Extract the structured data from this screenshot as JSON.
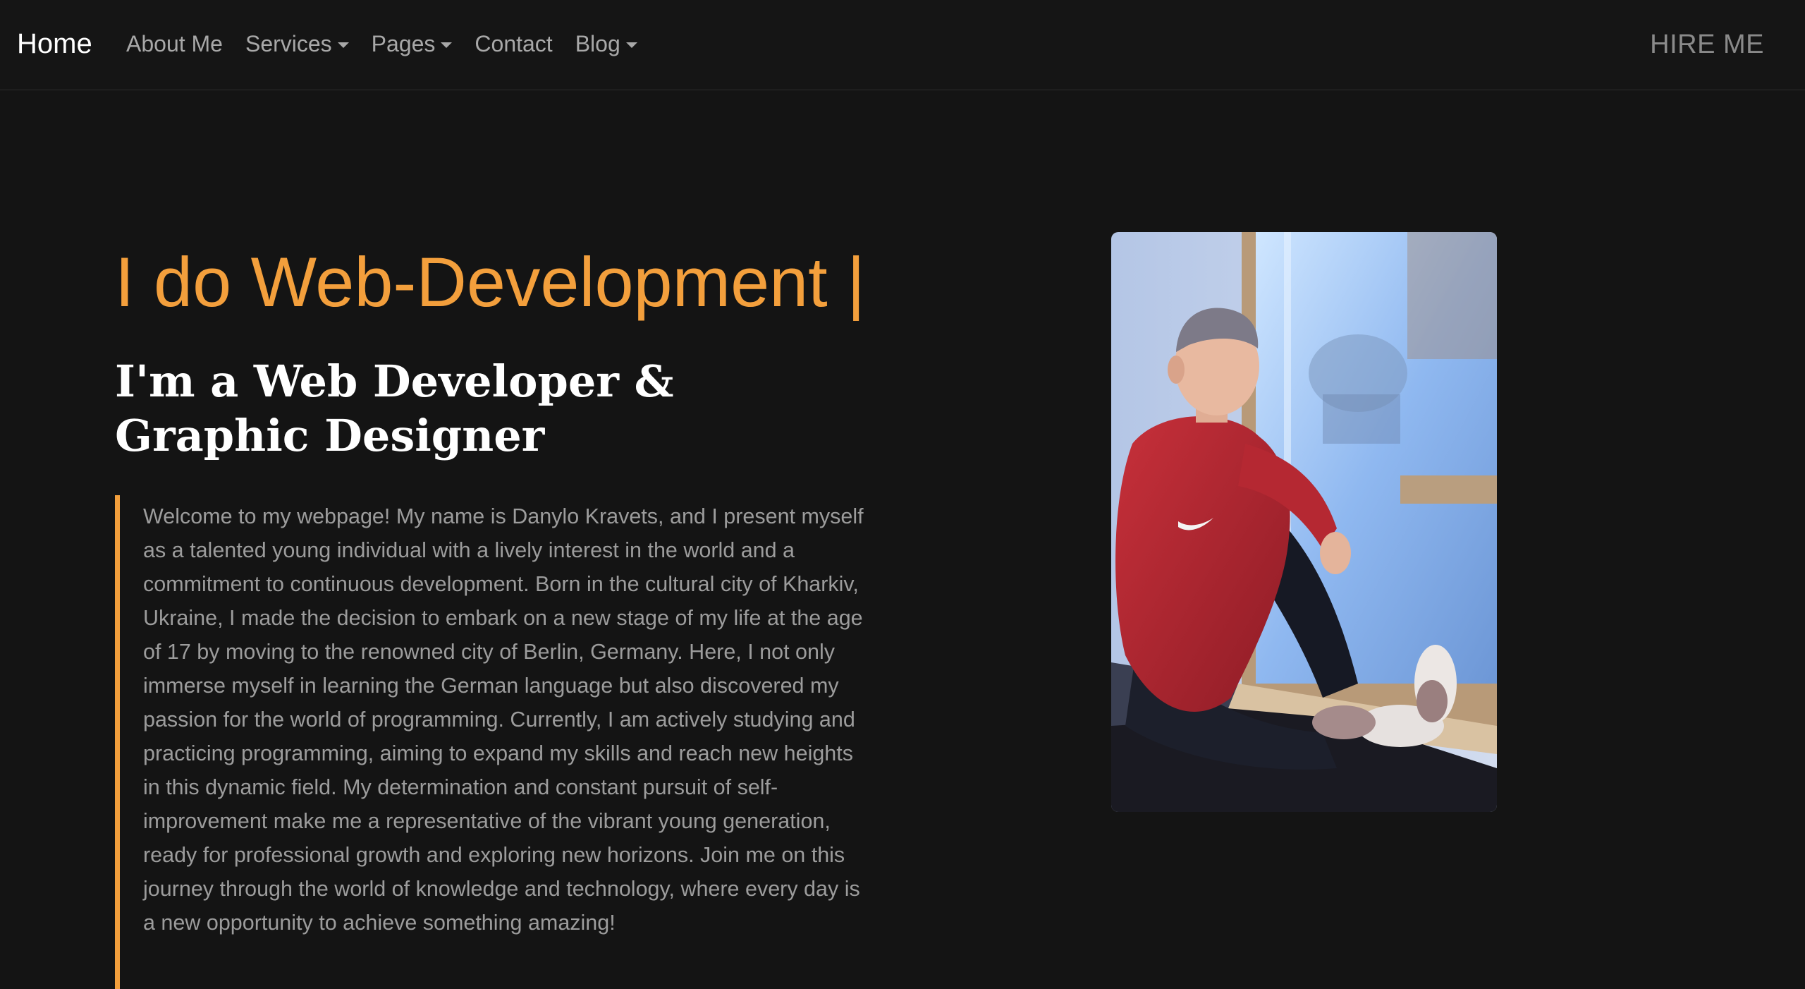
{
  "nav": {
    "brand": "Home",
    "links": [
      {
        "label": "About Me",
        "dropdown": false
      },
      {
        "label": "Services",
        "dropdown": true
      },
      {
        "label": "Pages",
        "dropdown": true
      },
      {
        "label": "Contact",
        "dropdown": false
      },
      {
        "label": "Blog",
        "dropdown": true
      }
    ],
    "hire": "HIRE ME"
  },
  "hero": {
    "typed_text": "I do Web-Development |",
    "subtitle": "I'm a Web Developer & Graphic Designer",
    "bio": "Welcome to my webpage! My name is Danylo Kravets, and I present myself as a talented young individual with a lively interest in the world and a commitment to continuous development. Born in the cultural city of Kharkiv, Ukraine, I made the decision to embark on a new stage of my life at the age of 17 by moving to the renowned city of Berlin, Germany. Here, I not only immerse myself in learning the German language but also discovered my passion for the world of programming. Currently, I am actively studying and practicing programming, aiming to expand my skills and reach new heights in this dynamic field. My determination and constant pursuit of self-improvement make me a representative of the vibrant young generation, ready for professional growth and exploring new horizons. Join me on this journey through the world of knowledge and technology, where every day is a new opportunity to achieve something amazing!"
  },
  "colors": {
    "background": "#141414",
    "accent": "#f39f3c",
    "text_muted": "#9c9c9c",
    "heading": "#ffffff"
  },
  "icons": {
    "dropdown": "caret-down-icon"
  }
}
